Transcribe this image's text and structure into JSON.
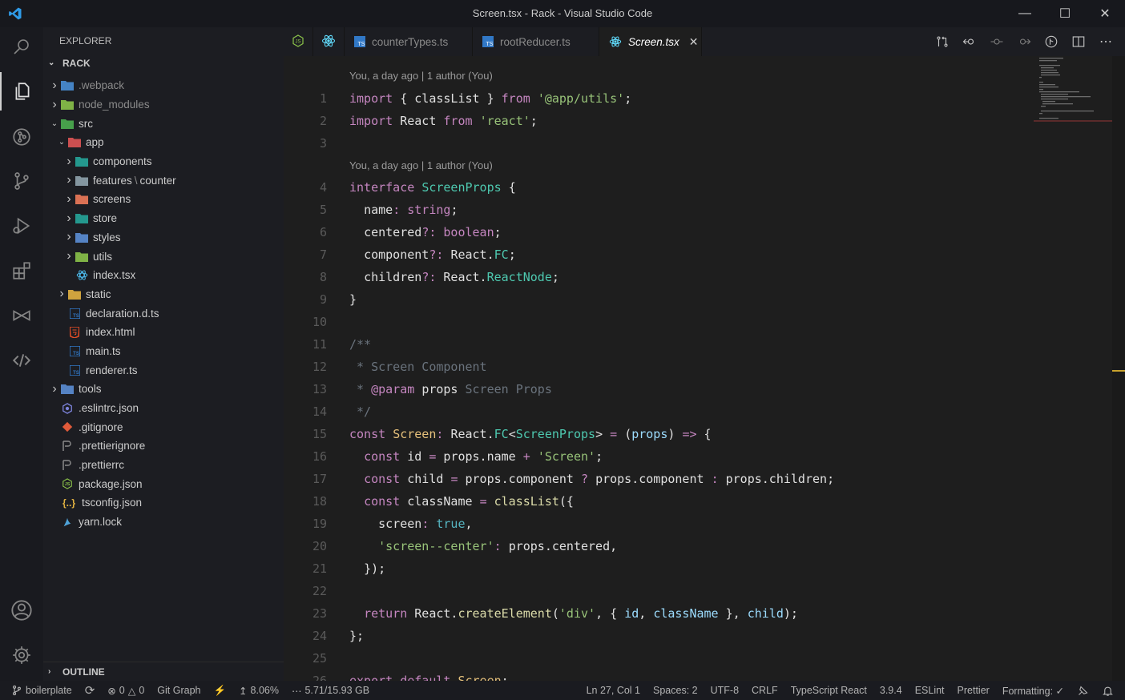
{
  "window": {
    "title": "Screen.tsx - Rack - Visual Studio Code"
  },
  "sidebar": {
    "header": "EXPLORER",
    "root": "RACK",
    "outline": "OUTLINE",
    "tree": [
      {
        "label": ".webpack",
        "depth": 0,
        "type": "folder",
        "dim": true,
        "color": "#4a8fd6"
      },
      {
        "label": "node_modules",
        "depth": 0,
        "type": "folder",
        "dim": true,
        "color": "#8bc34a"
      },
      {
        "label": "src",
        "depth": 0,
        "type": "folder-open",
        "dim": false,
        "color": "#4caf50"
      },
      {
        "label": "app",
        "depth": 1,
        "type": "folder-open",
        "dim": false,
        "color": "#e05555"
      },
      {
        "label": "components",
        "depth": 2,
        "type": "folder",
        "dim": false,
        "color": "#26a69a"
      },
      {
        "label": "features",
        "suffix": "counter",
        "depth": 2,
        "type": "folder",
        "dim": false,
        "color": "#90a4ae"
      },
      {
        "label": "screens",
        "depth": 2,
        "type": "folder",
        "dim": false,
        "color": "#ef7b5a"
      },
      {
        "label": "store",
        "depth": 2,
        "type": "folder",
        "dim": false,
        "color": "#26a69a"
      },
      {
        "label": "styles",
        "depth": 2,
        "type": "folder",
        "dim": false,
        "color": "#5c8fd6"
      },
      {
        "label": "utils",
        "depth": 2,
        "type": "folder",
        "dim": false,
        "color": "#8bc34a"
      },
      {
        "label": "index.tsx",
        "depth": 2,
        "type": "react",
        "dim": false,
        "color": "#4fc3f7"
      },
      {
        "label": "static",
        "depth": 1,
        "type": "folder",
        "dim": false,
        "color": "#e3b341"
      },
      {
        "label": "declaration.d.ts",
        "depth": 1,
        "type": "ts",
        "dim": false,
        "color": "#3178c6"
      },
      {
        "label": "index.html",
        "depth": 1,
        "type": "html",
        "dim": false,
        "color": "#e44d26"
      },
      {
        "label": "main.ts",
        "depth": 1,
        "type": "ts",
        "dim": false,
        "color": "#3178c6"
      },
      {
        "label": "renderer.ts",
        "depth": 1,
        "type": "ts",
        "dim": false,
        "color": "#3178c6"
      },
      {
        "label": "tools",
        "depth": 0,
        "type": "folder",
        "dim": false,
        "color": "#5c8fd6"
      },
      {
        "label": ".eslintrc.json",
        "depth": 0,
        "type": "eslint",
        "dim": false,
        "color": "#7c83db"
      },
      {
        "label": ".gitignore",
        "depth": 0,
        "type": "git",
        "dim": false,
        "color": "#e05a3a"
      },
      {
        "label": ".prettierignore",
        "depth": 0,
        "type": "prettier",
        "dim": false,
        "color": "#8a8a8a"
      },
      {
        "label": ".prettierrc",
        "depth": 0,
        "type": "prettier",
        "dim": false,
        "color": "#8a8a8a"
      },
      {
        "label": "package.json",
        "depth": 0,
        "type": "npm",
        "dim": false,
        "color": "#8bc34a"
      },
      {
        "label": "tsconfig.json",
        "depth": 0,
        "type": "json",
        "dim": false,
        "color": "#e3b341"
      },
      {
        "label": "yarn.lock",
        "depth": 0,
        "type": "yarn",
        "dim": false,
        "color": "#4fa3d9"
      }
    ]
  },
  "tabs": [
    {
      "label": "counterTypes.ts",
      "icon": "ts",
      "active": false
    },
    {
      "label": "rootReducer.ts",
      "icon": "ts",
      "active": false
    },
    {
      "label": "Screen.tsx",
      "icon": "react",
      "active": true
    }
  ],
  "editor": {
    "codelens_1": "You, a day ago | 1 author (You)",
    "codelens_2": "You, a day ago | 1 author (You)",
    "line_numbers": [
      "1",
      "2",
      "3",
      "4",
      "5",
      "6",
      "7",
      "8",
      "9",
      "10",
      "11",
      "12",
      "13",
      "14",
      "15",
      "16",
      "17",
      "18",
      "19",
      "20",
      "21",
      "22",
      "23",
      "24",
      "25",
      "26"
    ]
  },
  "status": {
    "branch": "boilerplate",
    "errors": "0",
    "warnings": "0",
    "git_graph": "Git Graph",
    "cpu": "8.06%",
    "memory": "5.71/15.93 GB",
    "cursor": "Ln 27, Col 1",
    "spaces": "Spaces: 2",
    "encoding": "UTF-8",
    "eol": "CRLF",
    "language": "TypeScript React",
    "ts_version": "3.9.4",
    "eslint": "ESLint",
    "prettier": "Prettier",
    "formatting": "Formatting: ✓"
  }
}
